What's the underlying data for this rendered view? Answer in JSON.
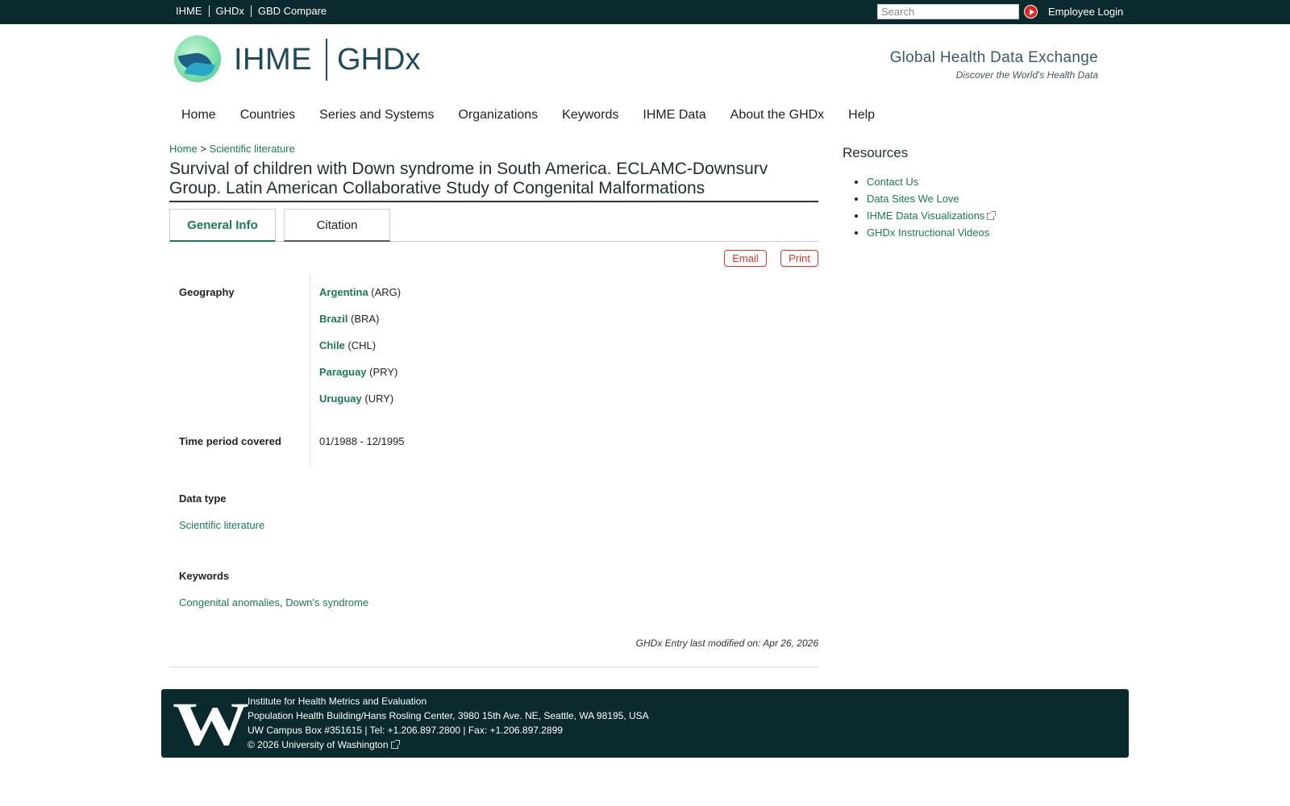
{
  "topbar": {
    "links": [
      "IHME",
      "GHDx",
      "GBD Compare"
    ],
    "search_placeholder": "Search",
    "employee_login": "Employee Login"
  },
  "header": {
    "logo_left": "IHME",
    "logo_right": "GHDx",
    "tagline_title": "Global Health Data Exchange",
    "tagline_sub": "Discover the World's Health Data"
  },
  "nav": [
    "Home",
    "Countries",
    "Series and Systems",
    "Organizations",
    "Keywords",
    "IHME Data",
    "About the GHDx",
    "Help"
  ],
  "breadcrumb": {
    "home": "Home",
    "separator": ">",
    "section": "Scientific literature"
  },
  "page_title": "Survival of children with Down syndrome in South America. ECLAMC-Downsurv Group. Latin American Collaborative Study of Congenital Malformations",
  "tabs": {
    "general": "General Info",
    "citation": "Citation"
  },
  "actions": {
    "email": "Email",
    "print": "Print"
  },
  "info": {
    "geography_label": "Geography",
    "geography": [
      {
        "name": "Argentina",
        "code": "(ARG)"
      },
      {
        "name": "Brazil",
        "code": "(BRA)"
      },
      {
        "name": "Chile",
        "code": "(CHL)"
      },
      {
        "name": "Paraguay",
        "code": "(PRY)"
      },
      {
        "name": "Uruguay",
        "code": "(URY)"
      }
    ],
    "time_label": "Time period covered",
    "time_value": "01/1988 - 12/1995",
    "data_type_label": "Data type",
    "data_type_value": "Scientific literature",
    "keywords_label": "Keywords",
    "keywords": [
      "Congenital anomalies",
      "Down's syndrome"
    ],
    "keywords_sep": ","
  },
  "modified": "GHDx Entry last modified on: Apr 26, 2026",
  "sidebar": {
    "title": "Resources",
    "items": [
      "Contact Us",
      "Data Sites We Love",
      "IHME Data Visualizations",
      "GHDx Instructional Videos"
    ]
  },
  "footer": {
    "logo": "W",
    "line1": "Institute for Health Metrics and Evaluation",
    "line2": "Population Health Building/Hans Rosling Center, 3980 15th Ave. NE, Seattle, WA 98195, USA",
    "line3": "UW Campus Box #351615 | Tel: +1.206.897.2800 | Fax: +1.206.897.2899",
    "copyright": "© 2026",
    "uw_link": "University of Washington"
  },
  "colors": {
    "topbar_bg": "#0a2a2e",
    "link_green": "#1a7a52",
    "accent_red": "#d9342b"
  }
}
